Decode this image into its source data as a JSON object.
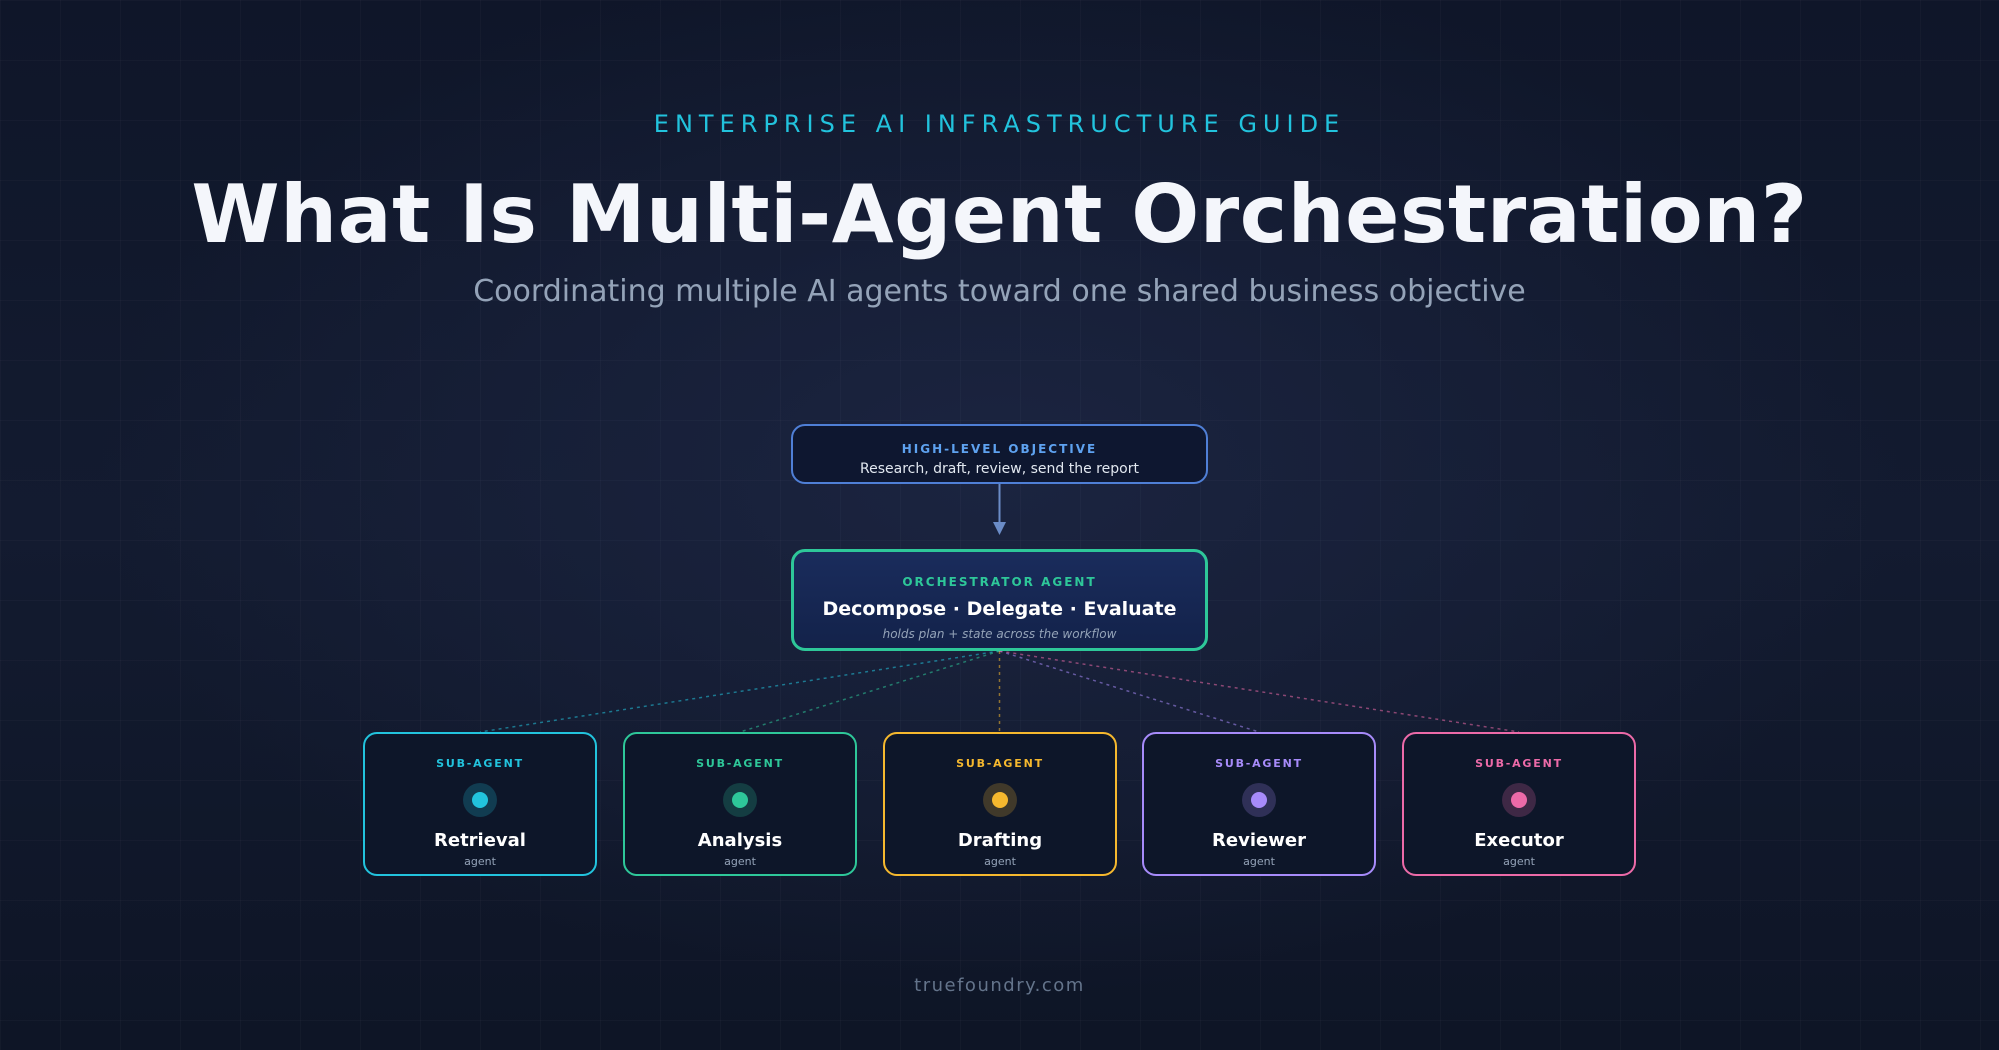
{
  "header": {
    "eyebrow": "ENTERPRISE AI INFRASTRUCTURE GUIDE",
    "title": "What Is Multi-Agent Orchestration?",
    "subtitle": "Coordinating multiple AI agents toward one shared business objective"
  },
  "objective": {
    "label": "HIGH-LEVEL OBJECTIVE",
    "text": "Research, draft, review, send the report"
  },
  "orchestrator": {
    "label": "ORCHESTRATOR AGENT",
    "title": "Decompose · Delegate · Evaluate",
    "note": "holds plan + state across the workflow"
  },
  "agents": [
    {
      "label": "SUB-AGENT",
      "name": "Retrieval",
      "sub": "agent",
      "color": "#22c3dd"
    },
    {
      "label": "SUB-AGENT",
      "name": "Analysis",
      "sub": "agent",
      "color": "#2ec799"
    },
    {
      "label": "SUB-AGENT",
      "name": "Drafting",
      "sub": "agent",
      "color": "#f5b82e"
    },
    {
      "label": "SUB-AGENT",
      "name": "Reviewer",
      "sub": "agent",
      "color": "#a78bfa"
    },
    {
      "label": "SUB-AGENT",
      "name": "Executor",
      "sub": "agent",
      "color": "#ec6aa8"
    }
  ],
  "footer": "truefoundry.com"
}
